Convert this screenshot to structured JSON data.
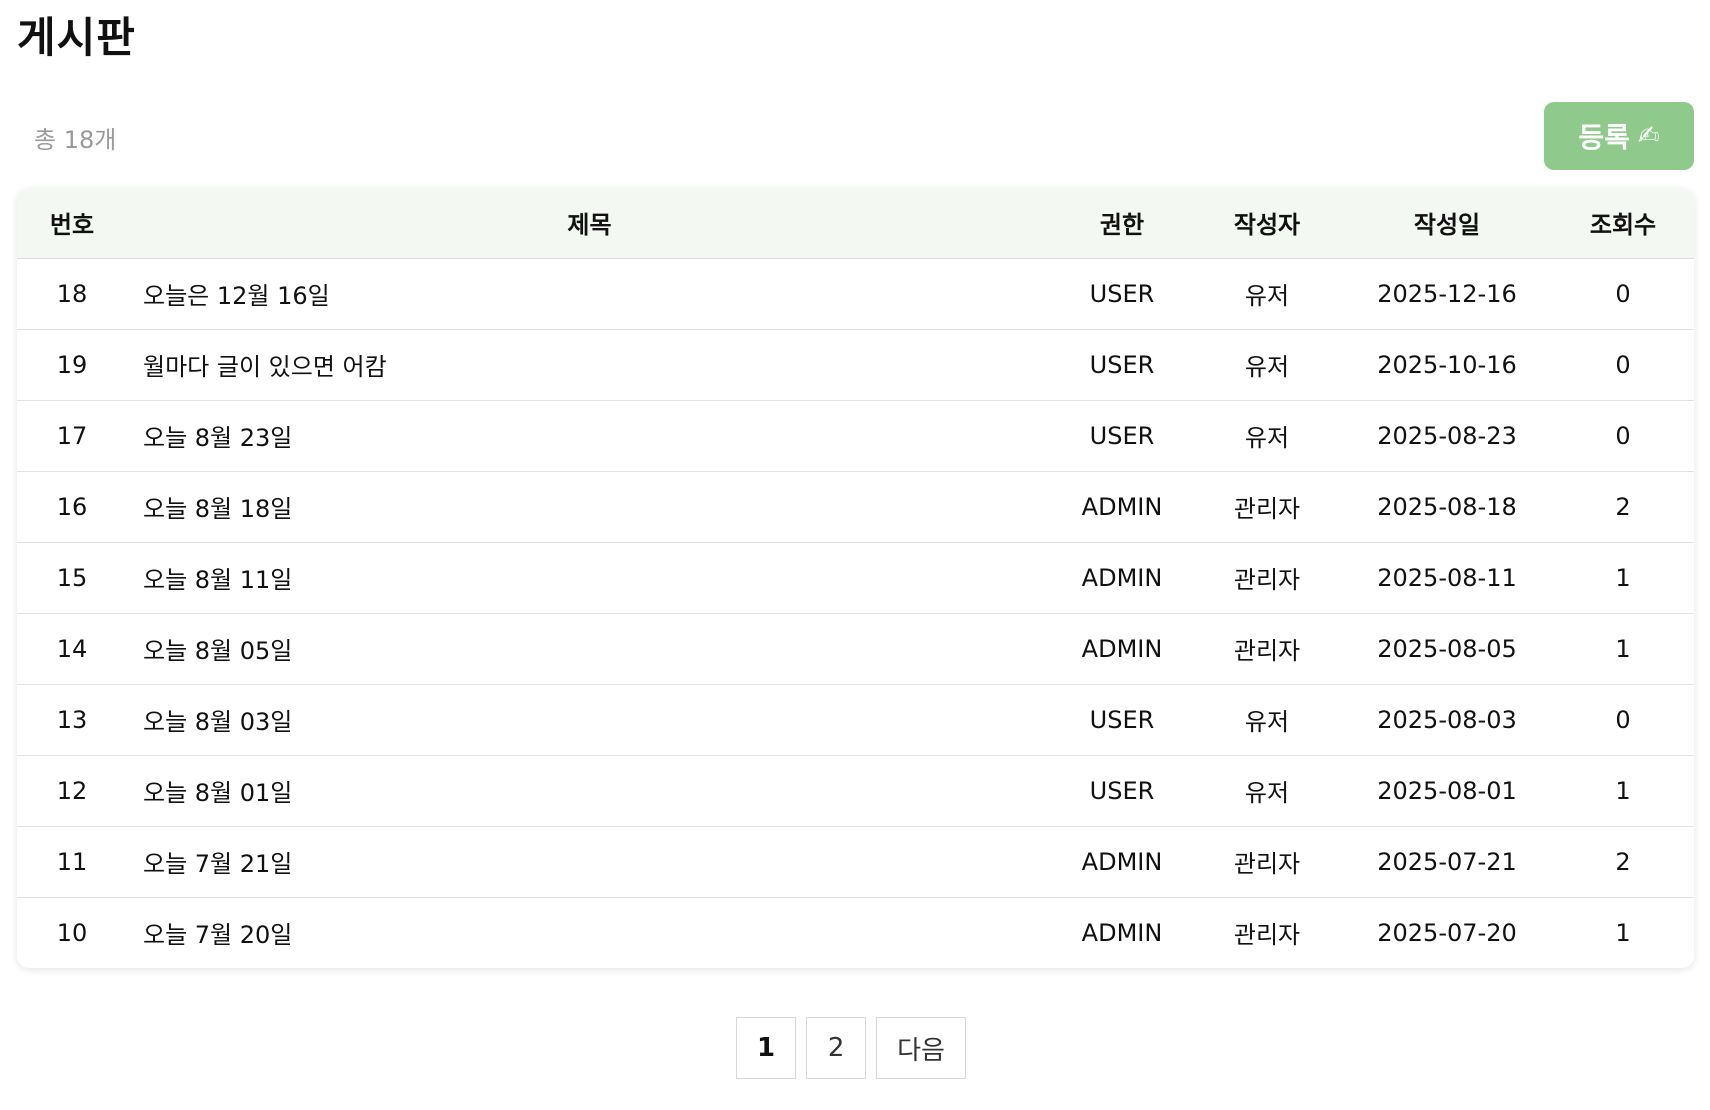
{
  "header": {
    "title": "게시판"
  },
  "toolbar": {
    "total_text": "총 18개",
    "register_label": "등록",
    "register_icon": "✍"
  },
  "table": {
    "columns": [
      "번호",
      "제목",
      "권한",
      "작성자",
      "작성일",
      "조회수"
    ],
    "rows": [
      {
        "no": "18",
        "title": "오늘은 12월 16일",
        "role": "USER",
        "author": "유저",
        "date": "2025-12-16",
        "views": "0"
      },
      {
        "no": "19",
        "title": "월마다 글이 있으면 어캄",
        "role": "USER",
        "author": "유저",
        "date": "2025-10-16",
        "views": "0"
      },
      {
        "no": "17",
        "title": "오늘 8월 23일",
        "role": "USER",
        "author": "유저",
        "date": "2025-08-23",
        "views": "0"
      },
      {
        "no": "16",
        "title": "오늘 8월 18일",
        "role": "ADMIN",
        "author": "관리자",
        "date": "2025-08-18",
        "views": "2"
      },
      {
        "no": "15",
        "title": "오늘 8월 11일",
        "role": "ADMIN",
        "author": "관리자",
        "date": "2025-08-11",
        "views": "1"
      },
      {
        "no": "14",
        "title": "오늘 8월 05일",
        "role": "ADMIN",
        "author": "관리자",
        "date": "2025-08-05",
        "views": "1"
      },
      {
        "no": "13",
        "title": "오늘 8월 03일",
        "role": "USER",
        "author": "유저",
        "date": "2025-08-03",
        "views": "0"
      },
      {
        "no": "12",
        "title": "오늘 8월 01일",
        "role": "USER",
        "author": "유저",
        "date": "2025-08-01",
        "views": "1"
      },
      {
        "no": "11",
        "title": "오늘 7월 21일",
        "role": "ADMIN",
        "author": "관리자",
        "date": "2025-07-21",
        "views": "2"
      },
      {
        "no": "10",
        "title": "오늘 7월 20일",
        "role": "ADMIN",
        "author": "관리자",
        "date": "2025-07-20",
        "views": "1"
      }
    ]
  },
  "pagination": {
    "pages": [
      "1",
      "2"
    ],
    "current": "1",
    "next_label": "다음"
  },
  "colors": {
    "accent": "#8fc98b",
    "header_bg": "#f4f8f2"
  }
}
